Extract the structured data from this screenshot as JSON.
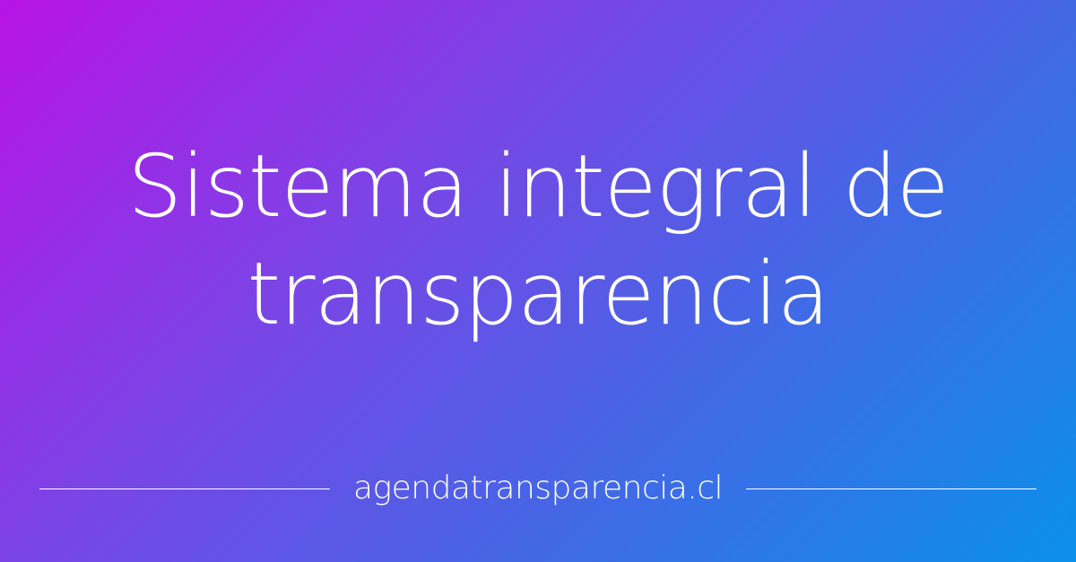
{
  "title": {
    "line1": "Sistema integral de",
    "line2": "transparencia"
  },
  "footer": {
    "site": "agendatransparencia.cl"
  },
  "colors": {
    "gradient_start": "#b813e6",
    "gradient_end": "#0a90ea",
    "text": "#ffffff"
  }
}
